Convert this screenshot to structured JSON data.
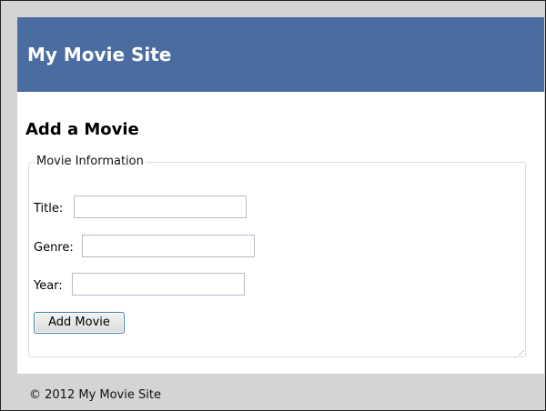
{
  "header": {
    "site_title": "My Movie Site"
  },
  "main": {
    "heading": "Add a Movie",
    "form": {
      "legend": "Movie Information",
      "fields": {
        "title": {
          "label": "Title:",
          "value": "",
          "placeholder": ""
        },
        "genre": {
          "label": "Genre:",
          "value": "",
          "placeholder": ""
        },
        "year": {
          "label": "Year:",
          "value": "",
          "placeholder": ""
        }
      },
      "submit_label": "Add Movie"
    }
  },
  "footer": {
    "copyright": "© 2012 My Movie Site"
  },
  "colors": {
    "header_background": "#4a6ca0",
    "page_background": "#d4d4d4",
    "content_background": "#ffffff"
  }
}
